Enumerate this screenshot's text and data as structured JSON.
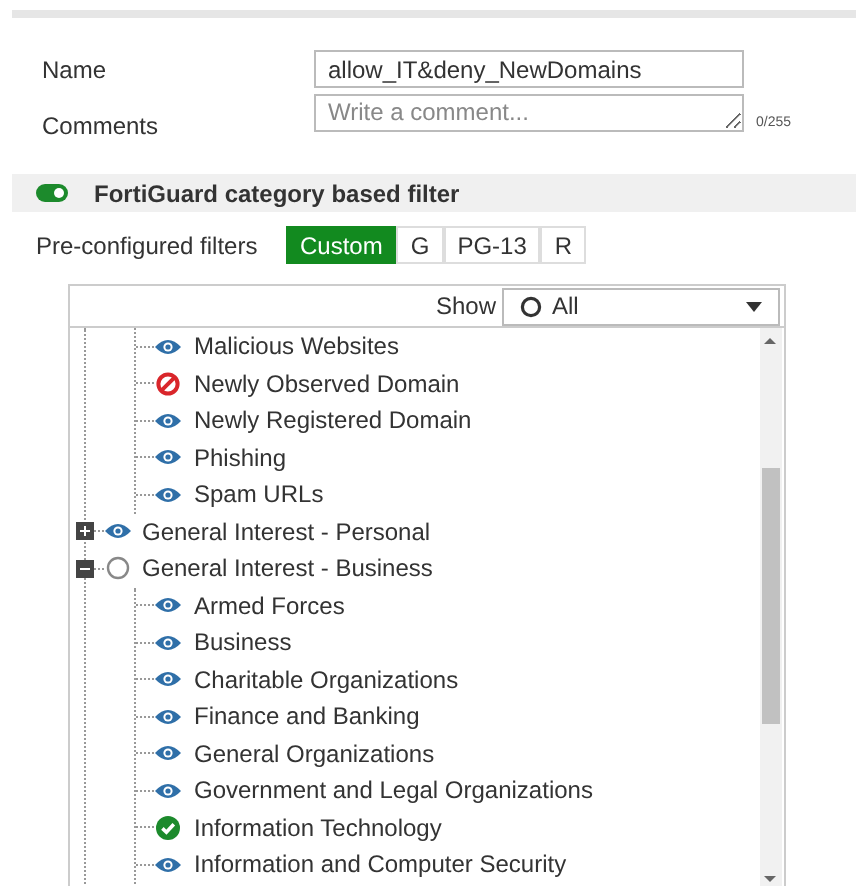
{
  "form": {
    "name_label": "Name",
    "name_value": "allow_IT&deny_NewDomains",
    "comments_label": "Comments",
    "comments_placeholder": "Write a comment...",
    "comments_counter": "0/255"
  },
  "category_filter": {
    "title": "FortiGuard category based filter",
    "enabled": true
  },
  "preconfigured": {
    "label": "Pre-configured filters",
    "options": [
      {
        "label": "Custom",
        "selected": true
      },
      {
        "label": "G",
        "selected": false
      },
      {
        "label": "PG-13",
        "selected": false
      },
      {
        "label": "R",
        "selected": false
      }
    ]
  },
  "show_filter": {
    "label": "Show",
    "value": "All"
  },
  "tree": [
    {
      "children": [
        {
          "label": "Malicious Websites",
          "kind": "monitor"
        },
        {
          "label": "Newly Observed Domain",
          "kind": "block"
        },
        {
          "label": "Newly Registered Domain",
          "kind": "monitor"
        },
        {
          "label": "Phishing",
          "kind": "monitor"
        },
        {
          "label": "Spam URLs",
          "kind": "monitor"
        }
      ]
    },
    {
      "label": "General Interest - Personal",
      "kind": "monitor",
      "expanded": false
    },
    {
      "label": "General Interest - Business",
      "kind": "none",
      "expanded": true,
      "children": [
        {
          "label": "Armed Forces",
          "kind": "monitor"
        },
        {
          "label": "Business",
          "kind": "monitor"
        },
        {
          "label": "Charitable Organizations",
          "kind": "monitor"
        },
        {
          "label": "Finance and Banking",
          "kind": "monitor"
        },
        {
          "label": "General Organizations",
          "kind": "monitor"
        },
        {
          "label": "Government and Legal Organizations",
          "kind": "monitor"
        },
        {
          "label": "Information Technology",
          "kind": "allow"
        },
        {
          "label": "Information and Computer Security",
          "kind": "monitor"
        }
      ]
    }
  ]
}
